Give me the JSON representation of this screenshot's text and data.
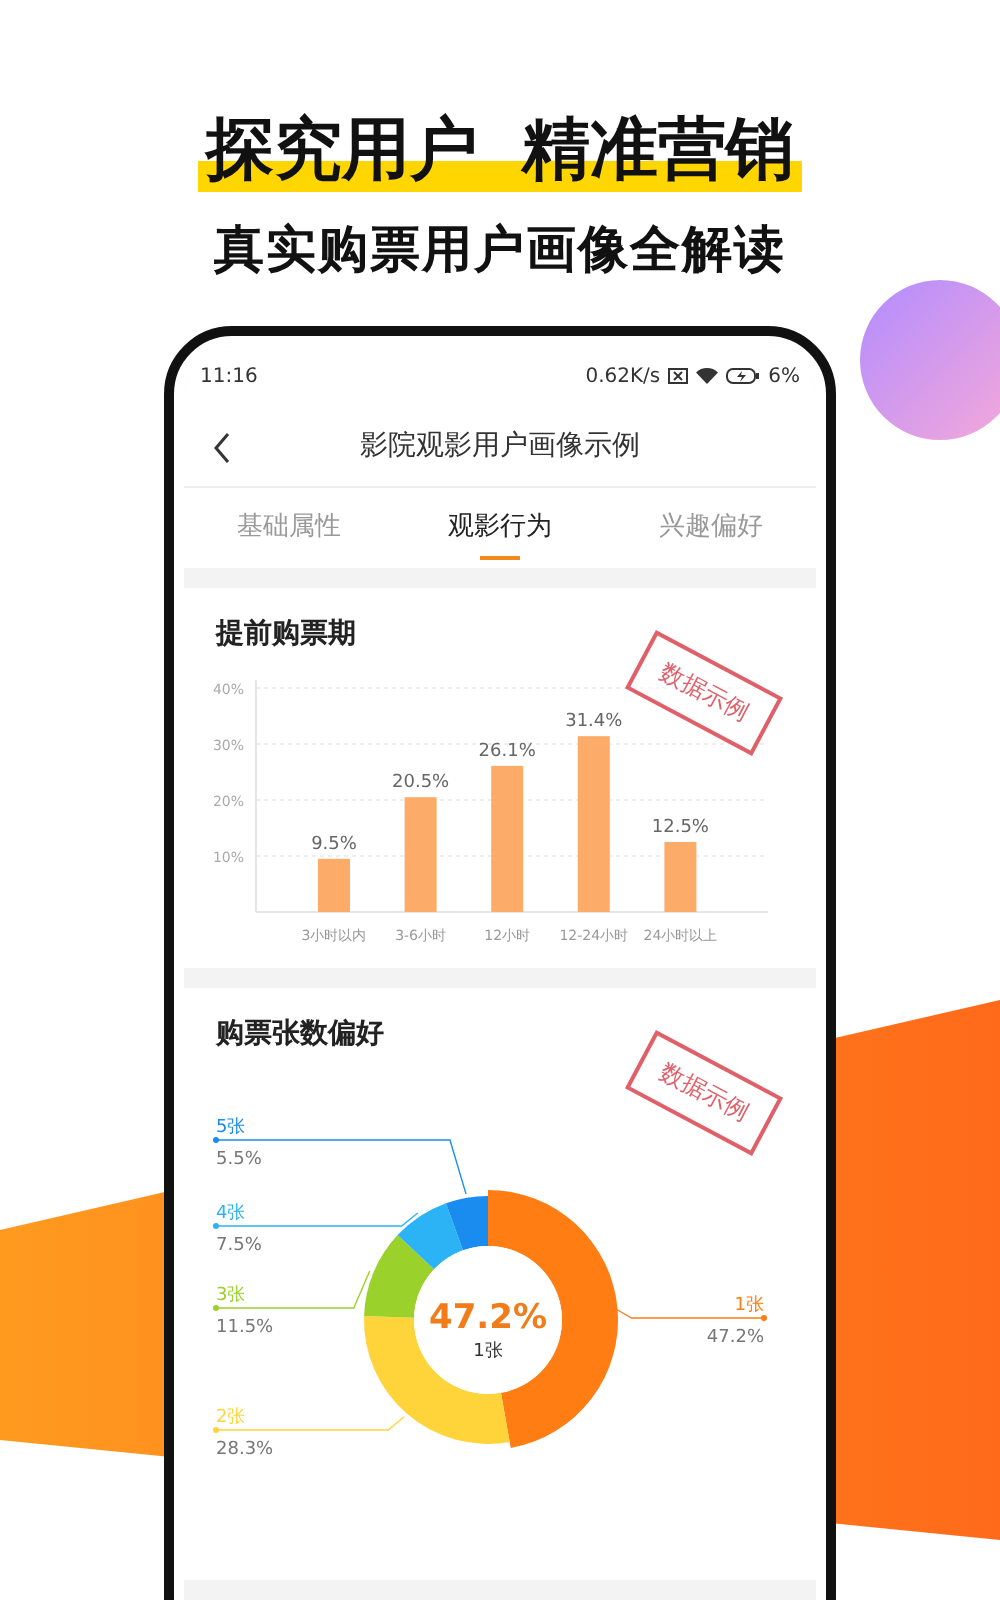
{
  "headline": [
    "探究用户",
    "精准营销"
  ],
  "subtitle": "真实购票用户画像全解读",
  "status_bar": {
    "time": "11:16",
    "speed": "0.62K/s",
    "battery": "6%"
  },
  "nav": {
    "title": "影院观影用户画像示例"
  },
  "tabs": [
    {
      "label": "基础属性",
      "selected": false
    },
    {
      "label": "观影行为",
      "selected": true
    },
    {
      "label": "兴趣偏好",
      "selected": false
    }
  ],
  "cards": [
    {
      "title": "提前购票期",
      "stamp": "数据示例",
      "chart_data": {
        "type": "bar",
        "categories": [
          "3小时以内",
          "3-6小时",
          "12小时",
          "12-24小时",
          "24小时以上"
        ],
        "values": [
          9.5,
          20.5,
          26.1,
          31.4,
          12.5
        ],
        "ylim": [
          0,
          40
        ],
        "yticks": [
          {
            "value": 10,
            "label": "10%"
          },
          {
            "value": 20,
            "label": "20%"
          },
          {
            "value": 30,
            "label": "30%"
          },
          {
            "value": 40,
            "label": "40%"
          }
        ],
        "grid": true,
        "value_labels": [
          "9.5%",
          "20.5%",
          "26.1%",
          "31.4%",
          "12.5%"
        ]
      }
    },
    {
      "title": "购票张数偏好",
      "stamp": "数据示例",
      "center_value": "47.2%",
      "center_label": "1张",
      "chart_data": {
        "type": "donut",
        "categories": [
          "1张",
          "2张",
          "3张",
          "4张",
          "5张"
        ],
        "values": [
          47.2,
          28.3,
          11.5,
          7.5,
          5.5
        ],
        "colors": [
          "#ff7d12",
          "#ffd43b",
          "#9ad12b",
          "#2bb3f5",
          "#1a8cf0"
        ],
        "legend": true,
        "value_labels": [
          "47.2%",
          "28.3%",
          "11.5%",
          "7.5%",
          "5.5%"
        ]
      }
    }
  ]
}
